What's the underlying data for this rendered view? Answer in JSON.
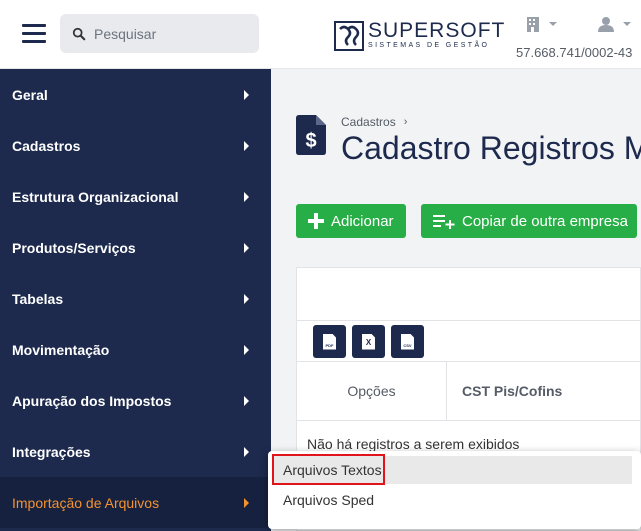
{
  "sidebar": {
    "search_placeholder": "Pesquisar",
    "items": [
      {
        "label": "Geral"
      },
      {
        "label": "Cadastros"
      },
      {
        "label": "Estrutura Organizacional"
      },
      {
        "label": "Produtos/Serviços"
      },
      {
        "label": "Tabelas"
      },
      {
        "label": "Movimentação"
      },
      {
        "label": "Apuração dos Impostos"
      },
      {
        "label": "Integrações"
      },
      {
        "label": "Importação de Arquivos",
        "active": true
      }
    ],
    "accent_color": "#f4922f",
    "bg_color": "#1d2a4d"
  },
  "header": {
    "logo_name": "SUPERSOFT",
    "logo_sub": "SISTEMAS DE GESTÃO",
    "company_icon": "building-icon",
    "user_icon": "user-icon",
    "cnpj": "57.668.741/0002-43"
  },
  "main": {
    "breadcrumb": "Cadastros",
    "title": "Cadastro Registros M",
    "buttons": {
      "add_label": "Adicionar",
      "copy_label": "Copiar de outra empresa"
    },
    "export": {
      "pdf": "PDF",
      "xls": "X",
      "csv": "CSV"
    },
    "table": {
      "columns": [
        "Opções",
        "CST Pis/Cofins"
      ],
      "empty_message": "Não há registros a serem exibidos"
    }
  },
  "dropdown": {
    "items": [
      {
        "label": "Arquivos Textos",
        "highlighted": true
      },
      {
        "label": "Arquivos Sped"
      }
    ],
    "highlight_color": "#e0141a"
  },
  "colors": {
    "primary_green": "#27ae46",
    "navy": "#1d2a4d"
  }
}
